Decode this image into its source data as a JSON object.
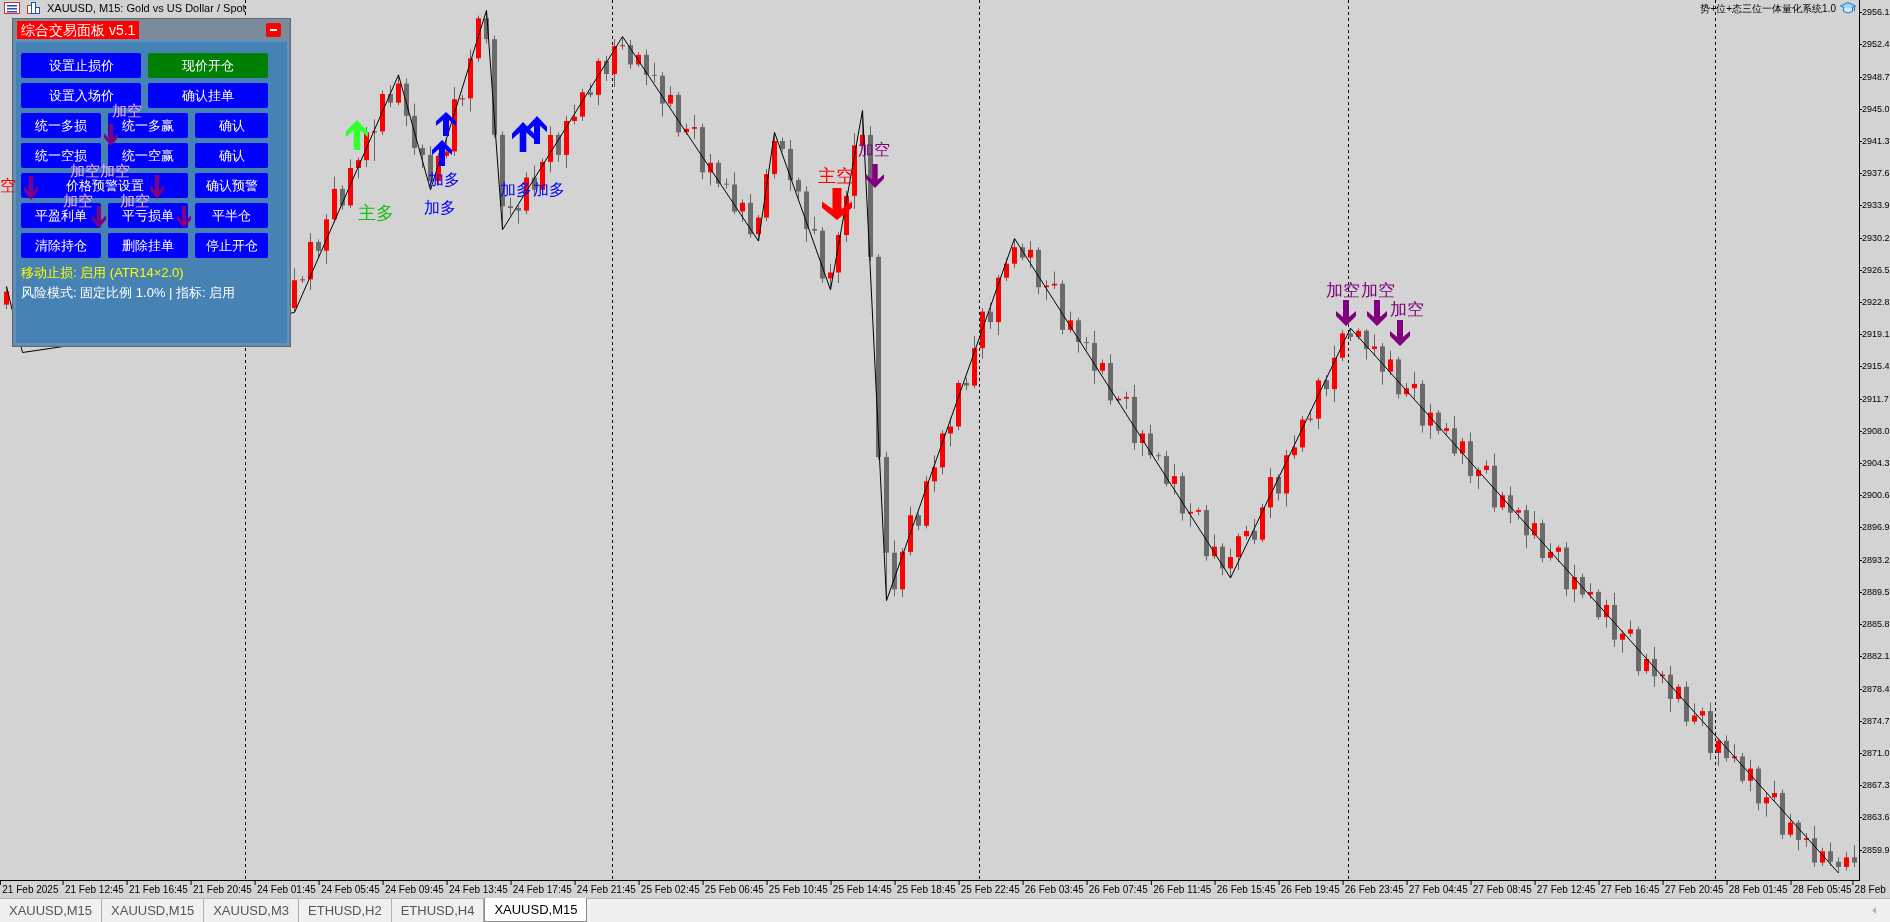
{
  "chart": {
    "title": "XAUUSD, M15: Gold vs US Dollar / Spot",
    "indicator": "势+位+态三位一体量化系统1.0",
    "signals": [
      {
        "kind": "main_short",
        "label": "空"
      },
      {
        "kind": "add_short",
        "label": "加空"
      },
      {
        "kind": "add_short",
        "label": "加空"
      },
      {
        "kind": "add_short",
        "label": "加空"
      },
      {
        "kind": "add_short",
        "label": "加空"
      },
      {
        "kind": "add_short",
        "label": "加空"
      },
      {
        "kind": "main_long",
        "label": "主多"
      },
      {
        "kind": "add_long",
        "label": "加多"
      },
      {
        "kind": "add_long",
        "label": "加多"
      },
      {
        "kind": "add_long",
        "label": "加多"
      },
      {
        "kind": "add_long",
        "label": "加多"
      },
      {
        "kind": "main_short",
        "label": "主空"
      },
      {
        "kind": "add_short",
        "label": "加空"
      },
      {
        "kind": "add_short",
        "label": "加空"
      },
      {
        "kind": "add_short",
        "label": "加空"
      },
      {
        "kind": "add_short",
        "label": "加空"
      }
    ],
    "chart_data": {
      "type": "candlestick",
      "ylim": [
        2856.4,
        2957.5
      ],
      "categories": [
        null,
        null,
        null,
        "21 Feb 2025",
        null,
        null,
        null,
        null,
        null,
        null,
        null,
        "21 Feb 12:45",
        null,
        null,
        null,
        null,
        null,
        null,
        null,
        "21 Feb 16:45",
        null,
        null,
        null,
        null,
        null,
        null,
        null,
        "21 Feb 20:45",
        null,
        null,
        null,
        null,
        null,
        null,
        null,
        "24 Feb 01:45",
        null,
        null,
        null,
        null,
        null,
        null,
        null,
        "24 Feb 05:45",
        null,
        null,
        null,
        null,
        null,
        null,
        null,
        "24 Feb 09:45",
        null,
        null,
        null,
        null,
        null,
        null,
        null,
        "24 Feb 13:45",
        null,
        null,
        null,
        null,
        null,
        null,
        null,
        "24 Feb 17:45",
        null,
        null,
        null,
        null,
        null,
        null,
        null,
        "24 Feb 21:45",
        null,
        null,
        null,
        null,
        null,
        null,
        null,
        "25 Feb 02:45",
        null,
        null,
        null,
        null,
        null,
        null,
        null,
        "25 Feb 06:45",
        null,
        null,
        null,
        null,
        null,
        null,
        null,
        "25 Feb 10:45",
        null,
        null,
        null,
        null,
        null,
        null,
        null,
        "25 Feb 14:45",
        null,
        null,
        null,
        null,
        null,
        null,
        null,
        "25 Feb 18:45",
        null,
        null,
        null,
        null,
        null,
        null,
        null,
        "25 Feb 22:45",
        null,
        null,
        null,
        null,
        null,
        null,
        null,
        "26 Feb 03:45",
        null,
        null,
        null,
        null,
        null,
        null,
        null,
        "26 Feb 07:45",
        null,
        null,
        null,
        null,
        null,
        null,
        null,
        "26 Feb 11:45",
        null,
        null,
        null,
        null,
        null,
        null,
        null,
        "26 Feb 15:45",
        null,
        null,
        null,
        null,
        null,
        null,
        null,
        "26 Feb 19:45",
        null,
        null,
        null,
        null,
        null,
        null,
        null,
        "26 Feb 23:45",
        null,
        null,
        null,
        null,
        null,
        null,
        null,
        "27 Feb 04:45",
        null,
        null,
        null,
        null,
        null,
        null,
        null,
        "27 Feb 08:45",
        null,
        null,
        null,
        null,
        null,
        null,
        null,
        "27 Feb 12:45",
        null,
        null,
        null,
        null,
        null,
        null,
        null,
        "27 Feb 16:45",
        null,
        null,
        null,
        null,
        null,
        null,
        null,
        "27 Feb 20:45",
        null,
        null,
        null,
        null,
        null,
        null,
        null,
        "28 Feb 01:45",
        null,
        null,
        null,
        null,
        null,
        null,
        null,
        "28 Feb 05:45",
        null,
        null,
        null,
        null,
        null,
        "28 Feb"
      ],
      "ohlc": [
        [
          2922.5,
          2924.6,
          2922.0,
          2924.0
        ],
        null,
        null,
        null,
        null,
        null,
        null,
        null,
        null,
        null,
        null,
        null,
        null,
        null,
        null,
        null,
        null,
        null,
        null,
        null,
        null,
        null,
        null,
        null,
        null,
        null,
        null,
        null,
        null,
        null,
        null,
        null,
        null,
        null,
        null,
        null,
        [
          2922.1,
          2926.7,
          2921.6,
          2925.3
        ],
        [
          2925.3,
          2925.8,
          2925.0,
          2925.4
        ],
        [
          2925.4,
          2930.7,
          2924.2,
          2929.7
        ],
        [
          2929.7,
          2930.0,
          2927.9,
          2928.7
        ],
        [
          2928.7,
          2932.9,
          2927.2,
          2932.3
        ],
        [
          2932.3,
          2937.2,
          2931.9,
          2935.8
        ],
        [
          2935.8,
          2936.2,
          2933.4,
          2933.9
        ],
        [
          2933.9,
          2939.2,
          2933.6,
          2938.2
        ],
        [
          2938.2,
          2939.4,
          2937.0,
          2939.1
        ],
        [
          2939.1,
          2942.9,
          2938.3,
          2942.3
        ],
        [
          2942.3,
          2943.8,
          2939.0,
          2942.4
        ],
        [
          2942.4,
          2947.1,
          2942.0,
          2946.7
        ],
        [
          2946.7,
          2947.7,
          2945.2,
          2945.7
        ],
        [
          2945.7,
          2948.9,
          2945.4,
          2947.9
        ],
        [
          2947.9,
          2948.5,
          2943.0,
          2944.2
        ],
        [
          2944.2,
          2945.6,
          2939.7,
          2940.5
        ],
        [
          2940.5,
          2940.9,
          2938.2,
          2939.7
        ],
        [
          2939.7,
          2940.7,
          2935.7,
          2936.7
        ],
        [
          2936.7,
          2939.9,
          2936.2,
          2939.6
        ],
        [
          2939.6,
          2941.4,
          2939.3,
          2940.1
        ],
        [
          2940.1,
          2947.5,
          2939.6,
          2946.1
        ],
        [
          2946.1,
          2946.6,
          2945.3,
          2946.2
        ],
        [
          2946.2,
          2951.8,
          2944.7,
          2950.8
        ],
        [
          2950.8,
          2955.7,
          2950.4,
          2955.4
        ],
        [
          2955.4,
          2956.3,
          2952.5,
          2953.0
        ],
        [
          2953.0,
          2953.4,
          2941.7,
          2942.0
        ],
        [
          2942.0,
          2942.4,
          2931.1,
          2933.8
        ],
        [
          2933.8,
          2934.8,
          2932.8,
          2933.6
        ],
        [
          2933.6,
          2933.9,
          2931.8,
          2933.3
        ],
        [
          2933.3,
          2937.7,
          2932.9,
          2937.1
        ],
        [
          2937.1,
          2938.5,
          2935.2,
          2935.7
        ],
        [
          2935.7,
          2939.3,
          2935.4,
          2938.9
        ],
        [
          2938.9,
          2943.0,
          2937.7,
          2942.0
        ],
        [
          2942.0,
          2942.3,
          2938.9,
          2939.7
        ],
        [
          2939.7,
          2944.2,
          2938.2,
          2943.6
        ],
        [
          2943.6,
          2945.5,
          2943.2,
          2944.1
        ],
        [
          2944.1,
          2947.3,
          2943.6,
          2946.9
        ],
        [
          2946.9,
          2947.9,
          2946.3,
          2946.6
        ],
        [
          2946.6,
          2950.8,
          2945.4,
          2950.5
        ],
        [
          2950.5,
          2951.1,
          2948.2,
          2949.0
        ],
        [
          2949.0,
          2953.0,
          2947.5,
          2952.2
        ],
        [
          2952.2,
          2953.3,
          2951.8,
          2952.3
        ],
        [
          2952.3,
          2952.9,
          2949.6,
          2950.1
        ],
        [
          2950.1,
          2951.5,
          2949.8,
          2951.2
        ],
        [
          2951.2,
          2951.8,
          2947.7,
          2948.9
        ],
        [
          2948.9,
          2950.3,
          2948.0,
          2948.8
        ],
        [
          2948.8,
          2949.2,
          2944.1,
          2945.6
        ],
        [
          2945.6,
          2947.6,
          2945.2,
          2946.6
        ],
        [
          2946.6,
          2946.9,
          2941.8,
          2942.3
        ],
        [
          2942.3,
          2943.3,
          2942.0,
          2942.7
        ],
        [
          2942.7,
          2944.3,
          2941.5,
          2942.9
        ],
        [
          2942.9,
          2943.3,
          2936.9,
          2937.7
        ],
        [
          2937.7,
          2939.8,
          2936.2,
          2938.8
        ],
        [
          2938.8,
          2939.1,
          2936.0,
          2936.4
        ],
        [
          2936.4,
          2937.0,
          2935.8,
          2936.3
        ],
        [
          2936.3,
          2937.7,
          2932.9,
          2933.2
        ],
        [
          2933.2,
          2934.6,
          2932.0,
          2934.2
        ],
        [
          2934.2,
          2935.2,
          2930.2,
          2930.6
        ],
        [
          2930.6,
          2932.8,
          2929.8,
          2932.5
        ],
        [
          2932.5,
          2938.1,
          2932.1,
          2937.5
        ],
        [
          2937.5,
          2942.3,
          2937.0,
          2941.3
        ],
        [
          2941.3,
          2941.7,
          2940.1,
          2940.4
        ],
        [
          2940.4,
          2941.4,
          2935.6,
          2936.8
        ],
        [
          2936.8,
          2937.1,
          2934.7,
          2935.5
        ],
        [
          2935.5,
          2936.1,
          2929.7,
          2931.2
        ],
        [
          2931.2,
          2932.6,
          2930.6,
          2931.0
        ],
        [
          2931.0,
          2931.4,
          2925.0,
          2925.5
        ],
        [
          2925.5,
          2927.2,
          2924.2,
          2926.2
        ],
        [
          2926.2,
          2930.8,
          2925.0,
          2930.5
        ],
        [
          2930.5,
          2935.6,
          2929.7,
          2935.0
        ],
        [
          2935.0,
          2942.2,
          2933.5,
          2940.8
        ],
        [
          2940.8,
          2944.8,
          2940.4,
          2942.0
        ],
        [
          2942.0,
          2943.0,
          2927.5,
          2928.0
        ],
        [
          2928.0,
          2928.3,
          2904.7,
          2905.0
        ],
        [
          2905.0,
          2905.6,
          2888.5,
          2894.0
        ],
        [
          2894.0,
          2895.4,
          2889.0,
          2889.8
        ],
        [
          2889.8,
          2894.5,
          2888.9,
          2894.1
        ],
        [
          2894.1,
          2899.3,
          2893.7,
          2898.3
        ],
        [
          2898.3,
          2898.6,
          2896.6,
          2897.1
        ],
        [
          2897.1,
          2902.8,
          2896.8,
          2902.2
        ],
        [
          2902.2,
          2905.2,
          2901.0,
          2903.8
        ],
        [
          2903.8,
          2908.1,
          2903.0,
          2907.7
        ],
        [
          2907.7,
          2909.5,
          2906.2,
          2908.5
        ],
        [
          2908.5,
          2913.8,
          2908.1,
          2913.5
        ],
        [
          2913.5,
          2914.1,
          2912.7,
          2913.2
        ],
        [
          2913.2,
          2918.9,
          2912.9,
          2917.5
        ],
        [
          2917.5,
          2922.1,
          2916.3,
          2921.7
        ],
        [
          2921.7,
          2922.7,
          2919.7,
          2920.5
        ],
        [
          2920.5,
          2925.9,
          2919.0,
          2925.6
        ],
        [
          2925.6,
          2927.8,
          2925.2,
          2927.2
        ],
        [
          2927.2,
          2930.1,
          2926.7,
          2929.1
        ],
        [
          2929.1,
          2929.5,
          2927.6,
          2927.9
        ],
        [
          2927.9,
          2929.8,
          2926.7,
          2928.8
        ],
        [
          2928.8,
          2929.1,
          2923.7,
          2924.5
        ],
        [
          2924.5,
          2925.3,
          2923.0,
          2924.7
        ],
        [
          2924.7,
          2926.3,
          2924.3,
          2924.9
        ],
        [
          2924.9,
          2925.3,
          2919.1,
          2919.6
        ],
        [
          2919.6,
          2921.7,
          2919.3,
          2920.7
        ],
        [
          2920.7,
          2921.0,
          2917.0,
          2918.2
        ],
        [
          2918.2,
          2918.8,
          2917.3,
          2918.1
        ],
        [
          2918.1,
          2919.5,
          2913.4,
          2914.9
        ],
        [
          2914.9,
          2916.2,
          2914.5,
          2915.8
        ],
        [
          2915.8,
          2916.8,
          2911.0,
          2911.5
        ],
        [
          2911.5,
          2912.0,
          2911.2,
          2911.7
        ],
        [
          2911.7,
          2912.5,
          2910.5,
          2911.9
        ],
        [
          2911.9,
          2913.3,
          2905.8,
          2906.6
        ],
        [
          2906.6,
          2908.1,
          2905.1,
          2907.7
        ],
        [
          2907.7,
          2908.7,
          2904.8,
          2905.2
        ],
        [
          2905.2,
          2905.5,
          2904.6,
          2905.1
        ],
        [
          2905.1,
          2905.7,
          2901.6,
          2901.9
        ],
        [
          2901.9,
          2904.2,
          2900.7,
          2902.8
        ],
        [
          2902.8,
          2903.2,
          2897.7,
          2898.5
        ],
        [
          2898.5,
          2899.7,
          2897.0,
          2898.7
        ],
        [
          2898.7,
          2899.2,
          2898.3,
          2898.9
        ],
        [
          2898.9,
          2899.5,
          2893.1,
          2893.6
        ],
        [
          2893.6,
          2896.1,
          2893.3,
          2894.7
        ],
        [
          2894.7,
          2895.1,
          2891.4,
          2892.2
        ],
        [
          2892.2,
          2894.5,
          2891.1,
          2893.5
        ],
        [
          2893.5,
          2896.2,
          2892.0,
          2895.9
        ],
        [
          2895.9,
          2897.1,
          2895.5,
          2896.5
        ],
        [
          2896.5,
          2897.9,
          2895.0,
          2895.5
        ],
        [
          2895.5,
          2899.6,
          2895.2,
          2899.2
        ],
        [
          2899.2,
          2903.7,
          2898.0,
          2902.7
        ],
        [
          2902.7,
          2903.0,
          2900.0,
          2900.8
        ],
        [
          2900.8,
          2905.8,
          2899.3,
          2905.2
        ],
        [
          2905.2,
          2907.5,
          2904.8,
          2906.1
        ],
        [
          2906.1,
          2909.7,
          2905.6,
          2909.3
        ],
        [
          2909.3,
          2910.4,
          2909.0,
          2909.4
        ],
        [
          2909.4,
          2914.1,
          2908.2,
          2913.8
        ],
        [
          2913.8,
          2914.4,
          2912.0,
          2912.8
        ],
        [
          2912.8,
          2917.8,
          2911.3,
          2916.4
        ],
        [
          2916.4,
          2919.6,
          2916.0,
          2919.2
        ],
        [
          2919.2,
          2919.8,
          2918.3,
          2918.8
        ],
        [
          2918.8,
          2919.8,
          2918.5,
          2919.5
        ],
        [
          2919.5,
          2919.7,
          2916.2,
          2917.4
        ],
        [
          2917.4,
          2919.1,
          2916.6,
          2917.7
        ],
        [
          2917.7,
          2918.1,
          2913.3,
          2914.8
        ],
        [
          2914.8,
          2917.2,
          2914.4,
          2916.2
        ],
        [
          2916.2,
          2916.5,
          2911.7,
          2912.2
        ],
        [
          2912.2,
          2913.5,
          2911.9,
          2912.9
        ],
        [
          2912.9,
          2914.8,
          2911.7,
          2913.4
        ],
        [
          2913.4,
          2913.8,
          2907.8,
          2908.6
        ],
        [
          2908.6,
          2911.1,
          2907.1,
          2910.1
        ],
        [
          2910.1,
          2910.4,
          2907.6,
          2908.0
        ],
        [
          2908.0,
          2908.9,
          2907.5,
          2908.3
        ],
        [
          2908.3,
          2909.7,
          2905.1,
          2905.4
        ],
        [
          2905.4,
          2907.2,
          2904.2,
          2906.8
        ],
        [
          2906.8,
          2907.8,
          2902.0,
          2902.8
        ],
        [
          2902.8,
          2903.8,
          2901.3,
          2903.5
        ],
        [
          2903.5,
          2904.6,
          2903.1,
          2904.0
        ],
        [
          2904.0,
          2905.4,
          2898.7,
          2899.2
        ],
        [
          2899.2,
          2901.0,
          2898.9,
          2900.6
        ],
        [
          2900.6,
          2901.6,
          2897.4,
          2898.6
        ],
        [
          2898.6,
          2899.2,
          2897.8,
          2898.9
        ],
        [
          2898.9,
          2899.5,
          2894.5,
          2896.0
        ],
        [
          2896.0,
          2898.8,
          2895.6,
          2897.4
        ],
        [
          2897.4,
          2897.8,
          2892.9,
          2893.4
        ],
        [
          2893.4,
          2895.1,
          2893.1,
          2894.1
        ],
        [
          2894.1,
          2894.9,
          2892.9,
          2894.6
        ],
        [
          2894.6,
          2895.2,
          2889.0,
          2889.8
        ],
        [
          2889.8,
          2892.6,
          2888.3,
          2891.2
        ],
        [
          2891.2,
          2891.6,
          2888.8,
          2889.2
        ],
        [
          2889.2,
          2890.5,
          2888.7,
          2889.5
        ],
        [
          2889.5,
          2889.8,
          2886.3,
          2886.6
        ],
        [
          2886.6,
          2888.6,
          2885.4,
          2888.0
        ],
        [
          2888.0,
          2889.4,
          2883.2,
          2884.0
        ],
        [
          2884.0,
          2885.1,
          2882.5,
          2884.7
        ],
        [
          2884.7,
          2886.2,
          2884.3,
          2885.2
        ],
        [
          2885.2,
          2885.5,
          2879.9,
          2880.4
        ],
        [
          2880.4,
          2882.4,
          2880.1,
          2881.8
        ],
        [
          2881.8,
          2883.2,
          2878.6,
          2879.8
        ],
        [
          2879.8,
          2880.4,
          2879.0,
          2880.0
        ],
        [
          2880.0,
          2881.0,
          2875.7,
          2877.2
        ],
        [
          2877.2,
          2878.9,
          2876.8,
          2878.6
        ],
        [
          2878.6,
          2879.2,
          2874.1,
          2874.6
        ],
        [
          2874.6,
          2876.7,
          2874.3,
          2875.3
        ],
        [
          2875.3,
          2876.2,
          2874.1,
          2875.8
        ],
        [
          2875.8,
          2876.8,
          2870.2,
          2871.0
        ],
        [
          2871.0,
          2872.7,
          2869.5,
          2872.4
        ],
        [
          2872.4,
          2873.0,
          2870.0,
          2870.4
        ],
        [
          2870.4,
          2872.0,
          2869.9,
          2870.6
        ],
        [
          2870.6,
          2871.0,
          2867.5,
          2867.8
        ],
        [
          2867.8,
          2870.2,
          2866.6,
          2869.2
        ],
        [
          2869.2,
          2869.5,
          2864.4,
          2865.2
        ],
        [
          2865.2,
          2866.5,
          2863.7,
          2865.9
        ],
        [
          2865.9,
          2867.8,
          2865.5,
          2866.4
        ],
        [
          2866.4,
          2866.8,
          2861.1,
          2861.6
        ],
        [
          2861.6,
          2864.0,
          2861.3,
          2863.0
        ],
        [
          2863.0,
          2863.3,
          2859.8,
          2861.0
        ],
        [
          2861.0,
          2861.8,
          2860.2,
          2861.2
        ],
        [
          2861.2,
          2862.6,
          2857.9,
          2858.4
        ],
        [
          2858.4,
          2860.1,
          2858.0,
          2859.7
        ],
        [
          2859.7,
          2860.7,
          2858.0,
          2858.5
        ],
        [
          2858.5,
          2859.0,
          2857.2,
          2857.9
        ],
        [
          2857.9,
          2859.6,
          2857.5,
          2859.0
        ],
        [
          2859.0,
          2860.4,
          2857.9,
          2858.4
        ],
        null,
        null
      ],
      "series": [
        {
          "type": "line",
          "color": "#000000",
          "values": [
            2924.6,
            null,
            2917.0,
            null,
            null,
            null,
            null,
            null,
            null,
            null,
            null,
            null,
            null,
            null,
            null,
            null,
            null,
            null,
            null,
            null,
            null,
            null,
            null,
            null,
            null,
            null,
            null,
            null,
            null,
            null,
            null,
            null,
            null,
            null,
            null,
            null,
            2921.6,
            null,
            null,
            null,
            null,
            null,
            null,
            null,
            null,
            null,
            null,
            null,
            null,
            2948.9,
            null,
            null,
            null,
            2935.7,
            null,
            null,
            null,
            null,
            null,
            null,
            2956.3,
            null,
            2931.1,
            null,
            null,
            null,
            null,
            null,
            null,
            null,
            null,
            null,
            null,
            null,
            null,
            null,
            null,
            2953.3,
            null,
            null,
            null,
            null,
            null,
            null,
            null,
            null,
            null,
            null,
            null,
            null,
            null,
            null,
            null,
            null,
            2929.8,
            null,
            2942.3,
            null,
            null,
            null,
            null,
            null,
            null,
            2924.2,
            null,
            null,
            null,
            2944.8,
            null,
            null,
            2888.5,
            null,
            null,
            null,
            null,
            null,
            null,
            null,
            null,
            null,
            null,
            null,
            null,
            null,
            null,
            null,
            2930.1,
            null,
            null,
            null,
            null,
            null,
            null,
            null,
            null,
            null,
            null,
            null,
            null,
            null,
            null,
            null,
            null,
            null,
            null,
            null,
            null,
            null,
            null,
            null,
            null,
            null,
            null,
            2891.1,
            null,
            null,
            null,
            null,
            null,
            null,
            null,
            null,
            null,
            null,
            null,
            null,
            null,
            null,
            2919.8,
            null,
            null,
            null,
            null,
            null,
            null,
            null,
            null,
            null,
            null,
            null,
            null,
            null,
            null,
            null,
            null,
            null,
            null,
            null,
            null,
            null,
            null,
            null,
            null,
            null,
            null,
            null,
            null,
            null,
            null,
            null,
            null,
            null,
            null,
            null,
            null,
            null,
            null,
            null,
            null,
            null,
            null,
            null,
            null,
            null,
            null,
            null,
            null,
            null,
            null,
            null,
            null,
            null,
            null,
            null,
            null,
            null,
            null,
            null,
            null,
            2857.2,
            null,
            null,
            null,
            null
          ]
        }
      ],
      "yticks": [
        {
          "value": 2956.1,
          "label": "2956.1"
        },
        {
          "value": 2952.4,
          "label": "2952.4"
        },
        {
          "value": 2948.7,
          "label": "2948.7"
        },
        {
          "value": 2945,
          "label": "2945.0"
        },
        {
          "value": 2941.3,
          "label": "2941.3"
        },
        {
          "value": 2937.6,
          "label": "2937.6"
        },
        {
          "value": 2933.9,
          "label": "2933.9"
        },
        {
          "value": 2930.2,
          "label": "2930.2"
        },
        {
          "value": 2926.5,
          "label": "2926.5"
        },
        {
          "value": 2922.8,
          "label": "2922.8"
        },
        {
          "value": 2919.1,
          "label": "2919.1"
        },
        {
          "value": 2915.4,
          "label": "2915.4"
        },
        {
          "value": 2911.7,
          "label": "2911.7"
        },
        {
          "value": 2908,
          "label": "2908.0"
        },
        {
          "value": 2904.3,
          "label": "2904.3"
        },
        {
          "value": 2900.6,
          "label": "2900.6"
        },
        {
          "value": 2896.9,
          "label": "2896.9"
        },
        {
          "value": 2893.2,
          "label": "2893.2"
        },
        {
          "value": 2889.5,
          "label": "2889.5"
        },
        {
          "value": 2885.8,
          "label": "2885.8"
        },
        {
          "value": 2882.1,
          "label": "2882.1"
        },
        {
          "value": 2878.4,
          "label": "2878.4"
        },
        {
          "value": 2874.7,
          "label": "2874.7"
        },
        {
          "value": 2871,
          "label": "2871.0"
        },
        {
          "value": 2867.3,
          "label": "2867.3"
        },
        {
          "value": 2863.6,
          "label": "2863.6"
        },
        {
          "value": 2859.9,
          "label": "2859.9"
        }
      ]
    }
  },
  "panel": {
    "title": "综合交易面板 v5.1",
    "top_buttons": [
      [
        {
          "label": "设置止损价",
          "color": "#0000ff"
        },
        {
          "label": "现价开仓",
          "color": "#008000"
        }
      ],
      [
        {
          "label": "设置入场价",
          "color": "#0000ff"
        },
        {
          "label": "确认挂单",
          "color": "#0000ff"
        }
      ]
    ],
    "grid_buttons": [
      [
        {
          "label": "统一多损",
          "color": "#0000ff"
        },
        {
          "label": "统一多赢",
          "color": "#0000ff"
        },
        {
          "label": "确认",
          "color": "#0000ff"
        }
      ],
      [
        {
          "label": "统一空损",
          "color": "#0000ff"
        },
        {
          "label": "统一空赢",
          "color": "#0000ff"
        },
        {
          "label": "确认",
          "color": "#0000ff"
        }
      ],
      [
        {
          "label": "价格预警设置",
          "color": "#0000ff"
        },
        {
          "label": "确认预警",
          "color": "#0000ff"
        }
      ],
      [
        {
          "label": "平盈利单",
          "color": "#0000ff"
        },
        {
          "label": "平亏损单",
          "color": "#0000ff"
        },
        {
          "label": "平半仓",
          "color": "#0000ff"
        }
      ],
      [
        {
          "label": "清除持仓",
          "color": "#0000ff"
        },
        {
          "label": "删除挂单",
          "color": "#0000ff"
        },
        {
          "label": "停止开仓",
          "color": "#0000ff"
        }
      ]
    ],
    "status_lines": [
      {
        "text": "移动止损: 启用 (ATR14×2.0)",
        "highlighted": true
      },
      {
        "text": "风险模式: 固定比例 1.0% | 指标: 启用",
        "highlighted": false
      }
    ]
  },
  "tabs": [
    {
      "label": "XAUUSD,M15",
      "selected": false
    },
    {
      "label": "XAUUSD,M15",
      "selected": false
    },
    {
      "label": "XAUUSD,M3",
      "selected": false
    },
    {
      "label": "ETHUSD,H2",
      "selected": false
    },
    {
      "label": "ETHUSD,H4",
      "selected": false
    },
    {
      "label": "XAUUSD,M15",
      "selected": true
    }
  ]
}
